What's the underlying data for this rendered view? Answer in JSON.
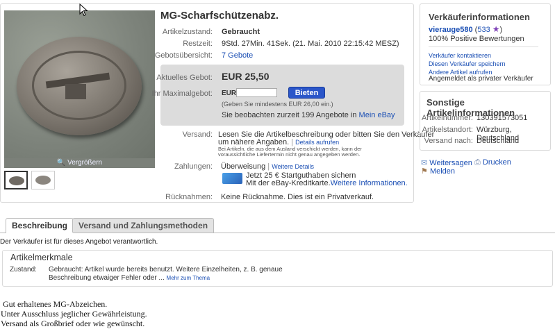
{
  "item": {
    "title": "MG-Scharfschützenabz.",
    "enlarge_label": "Vergrößern",
    "fields": {
      "zustand_label": "Artikelzustand:",
      "zustand_value": "Gebraucht",
      "restzeit_label": "Restzeit:",
      "restzeit_value": "9Std. 27Min. 41Sek. (21. Mai. 2010 22:15:42 MESZ)",
      "gebote_label": "Gebotsübersicht:",
      "gebote_value": "7 Gebote"
    },
    "bid": {
      "current_label": "Aktuelles Gebot:",
      "current_value": "EUR 25,50",
      "max_label": "Ihr Maximalgebot:",
      "currency": "EUR",
      "input_value": "",
      "button_label": "Bieten",
      "min_note": "(Geben Sie mindestens EUR 26,00 ein.)",
      "watching_text": "Sie beobachten zurzeit 199 Angebote in",
      "watching_link": "Mein eBay"
    },
    "versand": {
      "label": "Versand:",
      "text": "Lesen Sie die Artikelbeschreibung oder bitten Sie den Verkäufer",
      "text2": "um nähere Angaben.",
      "details_link": "Details aufrufen",
      "note1": "Bei Artikeln, die aus dem Ausland verschickt werden, kann der",
      "note2": "voraussichtliche Liefertermin nicht genau angegeben werden."
    },
    "zahlungen": {
      "label": "Zahlungen:",
      "method": "Überweisung",
      "details_link": "Weitere Details",
      "promo1": "Jetzt 25 € Startguthaben sichern",
      "promo2": "Mit der eBay-Kreditkarte.",
      "promo_link": "Weitere Informationen."
    },
    "rueck": {
      "label": "Rücknahmen:",
      "text": "Keine Rücknahme. Dies ist ein Privatverkauf."
    }
  },
  "seller": {
    "title": "Verkäuferinformationen",
    "name": "vierauge580",
    "score": "533",
    "positive": "100% Positive Bewertungen",
    "contact": "Verkäufer kontaktieren",
    "save": "Diesen Verkäufer speichern",
    "other": "Andere Artikel aufrufen",
    "private": "Angemeldet als privater Verkäufer"
  },
  "info": {
    "title": "Sonstige Artikelinformationen",
    "nummer_label": "Artikelnummer:",
    "nummer_value": "130391573051",
    "standort_label": "Artikelstandort:",
    "standort_value": "Würzburg, Deutschland",
    "versand_label": "Versand nach:",
    "versand_value": "Deutschland"
  },
  "actions": {
    "weitersagen": "Weitersagen",
    "drucken": "Drucken",
    "melden": "Melden"
  },
  "tabs": {
    "beschreibung": "Beschreibung",
    "versand": "Versand und Zahlungsmethoden"
  },
  "responsible": "Der Verkäufer ist für dieses Angebot verantwortlich.",
  "merkmale": {
    "title": "Artikelmerkmale",
    "zustand_label": "Zustand:",
    "text1": "Gebraucht: Artikel wurde bereits benutzt. Weitere Einzelheiten, z. B. genaue",
    "text2": "Beschreibung etwaiger Fehler oder ...",
    "more_link": "Mehr zum Thema"
  },
  "description": [
    "Gut erhaltenes MG-Abzeichen.",
    "Unter Ausschluss jeglicher Gewährleistung.",
    "Versand als Großbrief oder wie gewünscht."
  ],
  "colors": {
    "link": "#1b4fb4",
    "button": "#2b56c9",
    "bidbox": "#dcdcdc"
  }
}
